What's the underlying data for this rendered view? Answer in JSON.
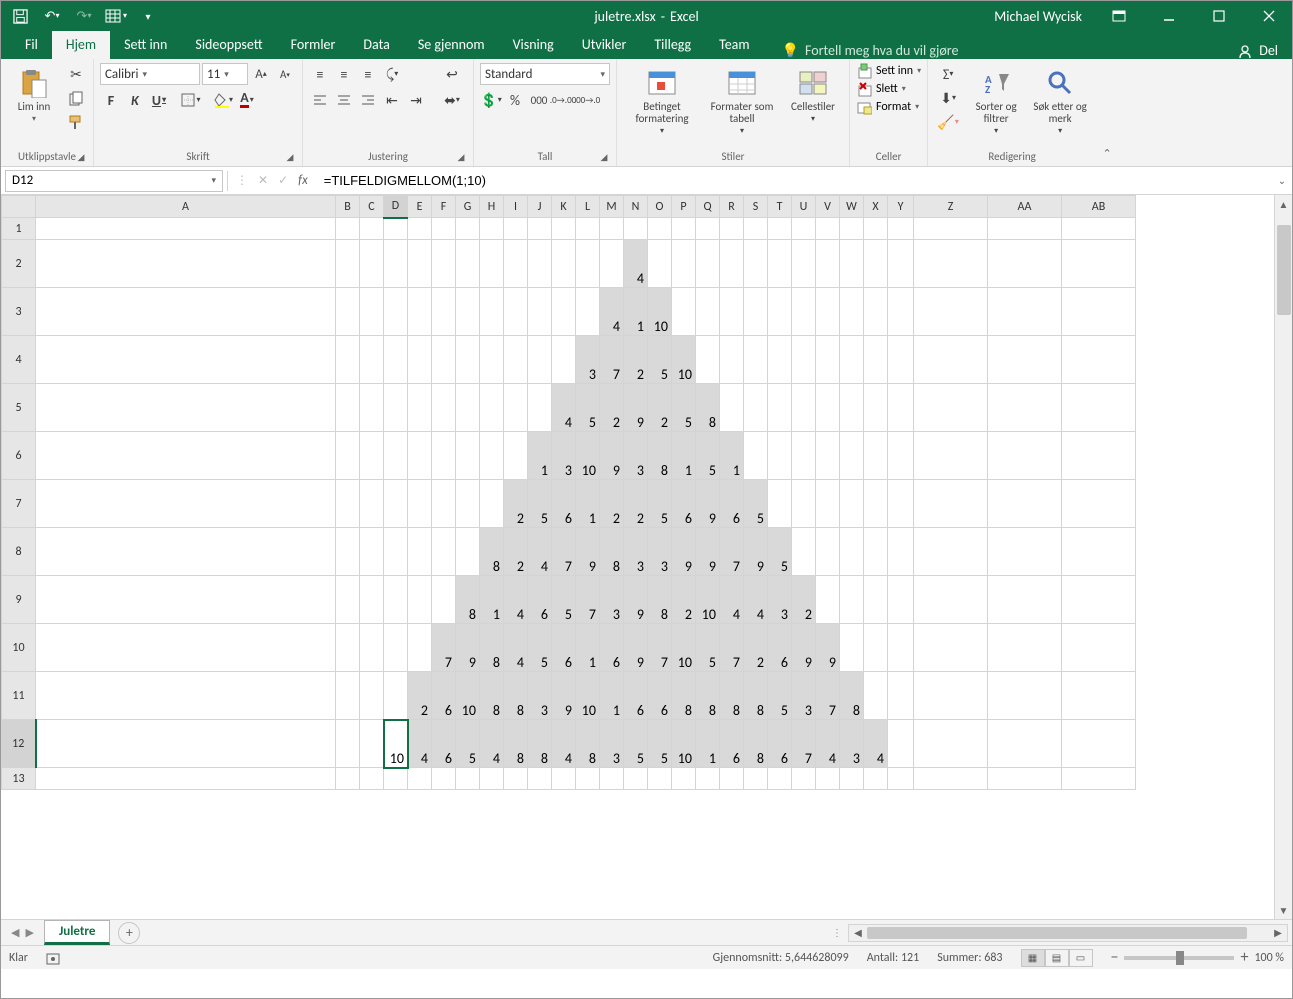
{
  "title": {
    "filename": "juletre.xlsx",
    "app": "Excel",
    "user": "Michael Wycisk"
  },
  "tabs": {
    "items": [
      "Fil",
      "Hjem",
      "Sett inn",
      "Sideoppsett",
      "Formler",
      "Data",
      "Se gjennom",
      "Visning",
      "Utvikler",
      "Tillegg",
      "Team"
    ],
    "active": 1,
    "tellme": "Fortell meg hva du vil gjøre",
    "share": "Del"
  },
  "ribbon": {
    "clipboard": {
      "paste": "Lim inn",
      "label": "Utklippstavle"
    },
    "font": {
      "name": "Calibri",
      "size": "11",
      "bold": "F",
      "italic": "K",
      "underline": "U",
      "label": "Skrift"
    },
    "align": {
      "label": "Justering"
    },
    "number": {
      "format": "Standard",
      "label": "Tall"
    },
    "styles": {
      "cond": "Betinget formatering",
      "table": "Formater som tabell",
      "cell": "Cellestiler",
      "label": "Stiler"
    },
    "cells": {
      "insert": "Sett inn",
      "delete": "Slett",
      "format": "Format",
      "label": "Celler"
    },
    "editing": {
      "sort": "Sorter og filtrer",
      "find": "Søk etter og merk",
      "label": "Redigering"
    }
  },
  "fbar": {
    "name": "D12",
    "formula": "=TILFELDIGMELLOM(1;10)"
  },
  "grid": {
    "columns": [
      "A",
      "B",
      "C",
      "D",
      "E",
      "F",
      "G",
      "H",
      "I",
      "J",
      "K",
      "L",
      "M",
      "N",
      "O",
      "P",
      "Q",
      "R",
      "S",
      "T",
      "U",
      "V",
      "W",
      "X",
      "Y",
      "Z",
      "AA",
      "AB"
    ],
    "rows": 13,
    "activeCell": [
      11,
      3
    ],
    "widths": {
      "A": 300,
      "default_narrow": 24,
      "default_wide": 74,
      "Y": 26
    },
    "data": {
      "1": {},
      "2": {
        "N": "4"
      },
      "3": {
        "M": "4",
        "N": "1",
        "O": "10"
      },
      "4": {
        "L": "3",
        "M": "7",
        "N": "2",
        "O": "5",
        "P": "10"
      },
      "5": {
        "K": "4",
        "L": "5",
        "M": "2",
        "N": "9",
        "O": "2",
        "P": "5",
        "Q": "8"
      },
      "6": {
        "J": "1",
        "K": "3",
        "L": "10",
        "M": "9",
        "N": "3",
        "O": "8",
        "P": "1",
        "Q": "5",
        "R": "1"
      },
      "7": {
        "I": "2",
        "J": "5",
        "K": "6",
        "L": "1",
        "M": "2",
        "N": "2",
        "O": "5",
        "P": "6",
        "Q": "9",
        "R": "6",
        "S": "5"
      },
      "8": {
        "H": "8",
        "I": "2",
        "J": "4",
        "K": "7",
        "L": "9",
        "M": "8",
        "N": "3",
        "O": "3",
        "P": "9",
        "Q": "9",
        "R": "7",
        "S": "9",
        "T": "5"
      },
      "9": {
        "G": "8",
        "H": "1",
        "I": "4",
        "J": "6",
        "K": "5",
        "L": "7",
        "M": "3",
        "N": "9",
        "O": "8",
        "P": "2",
        "Q": "10",
        "R": "4",
        "S": "4",
        "T": "3",
        "U": "2"
      },
      "10": {
        "F": "7",
        "G": "9",
        "H": "8",
        "I": "4",
        "J": "5",
        "K": "6",
        "L": "1",
        "M": "6",
        "N": "9",
        "O": "7",
        "P": "10",
        "Q": "5",
        "R": "7",
        "S": "2",
        "T": "6",
        "U": "9",
        "V": "9"
      },
      "11": {
        "E": "2",
        "F": "6",
        "G": "10",
        "H": "8",
        "I": "8",
        "J": "3",
        "K": "9",
        "L": "10",
        "M": "1",
        "N": "6",
        "O": "6",
        "P": "8",
        "Q": "8",
        "R": "8",
        "S": "8",
        "T": "5",
        "U": "3",
        "V": "7",
        "W": "8"
      },
      "12": {
        "D": "10",
        "E": "4",
        "F": "6",
        "G": "5",
        "H": "4",
        "I": "8",
        "J": "8",
        "K": "4",
        "L": "8",
        "M": "3",
        "N": "5",
        "O": "5",
        "P": "10",
        "Q": "1",
        "R": "6",
        "S": "8",
        "T": "6",
        "U": "7",
        "V": "4",
        "W": "3",
        "X": "4"
      }
    }
  },
  "sheets": {
    "active": "Juletre"
  },
  "status": {
    "ready": "Klar",
    "avg_label": "Gjennomsnitt:",
    "avg": "5,644628099",
    "count_label": "Antall:",
    "count": "121",
    "sum_label": "Summer:",
    "sum": "683",
    "zoom": "100 %"
  }
}
